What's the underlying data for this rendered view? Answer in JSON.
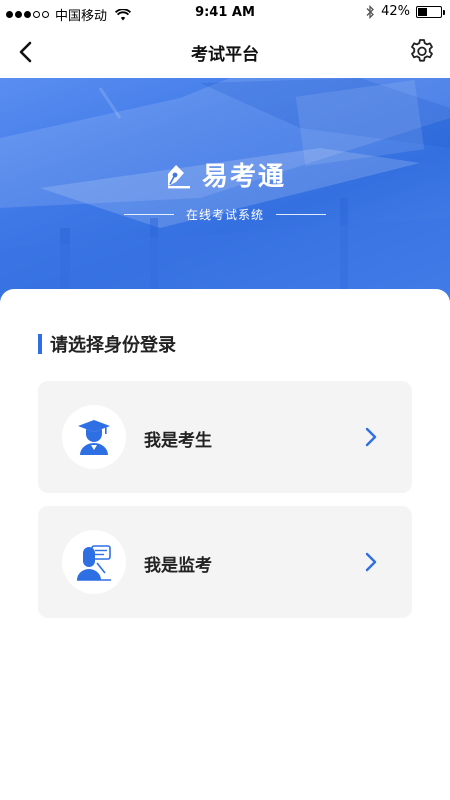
{
  "status_bar": {
    "carrier": "中国移动",
    "time": "9:41 AM",
    "battery_percent": "42%",
    "battery_level": 0.42
  },
  "nav": {
    "title": "考试平台"
  },
  "hero": {
    "brand_name": "易考通",
    "subtitle": "在线考试系统"
  },
  "section": {
    "title": "请选择身份登录"
  },
  "options": [
    {
      "label": "我是考生",
      "icon": "student-graduate-icon"
    },
    {
      "label": "我是监考",
      "icon": "proctor-teacher-icon"
    }
  ],
  "colors": {
    "accent": "#2f6fe4",
    "hero": "#3f79e8",
    "card_bg": "#f4f4f4"
  }
}
